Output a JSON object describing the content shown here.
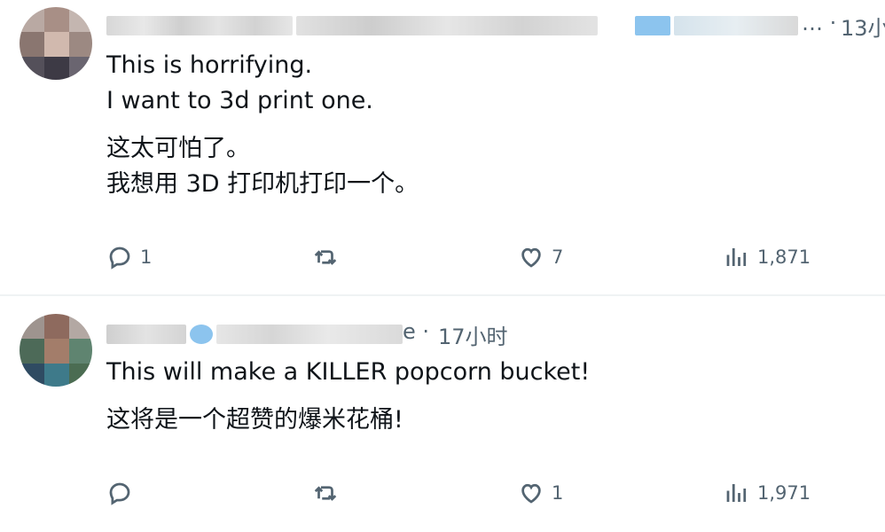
{
  "tweets": [
    {
      "timestamp_prefix": "… · ",
      "timestamp": "13小",
      "text_en": [
        "This is horrifying.",
        "I want to 3d print one."
      ],
      "text_zh": [
        "这太可怕了。",
        "我想用 3D 打印机打印一个。"
      ],
      "actions": {
        "replies": "1",
        "retweets": "",
        "likes": "7",
        "views": "1,871"
      }
    },
    {
      "timestamp_prefix": "e · ",
      "timestamp": "17小时",
      "text_en": [
        "This will make a KILLER popcorn bucket!"
      ],
      "text_zh": [
        "这将是一个超赞的爆米花桶!"
      ],
      "actions": {
        "replies": "",
        "retweets": "",
        "likes": "1",
        "views": "1,971"
      }
    }
  ],
  "icons": {
    "reply": "reply-icon",
    "retweet": "retweet-icon",
    "like": "heart-icon",
    "views": "views-chart-icon"
  },
  "colors": {
    "text_primary": "#0f1419",
    "text_secondary": "#536471",
    "verified_blue": "#1d9bf0",
    "divider": "#eff3f4"
  }
}
